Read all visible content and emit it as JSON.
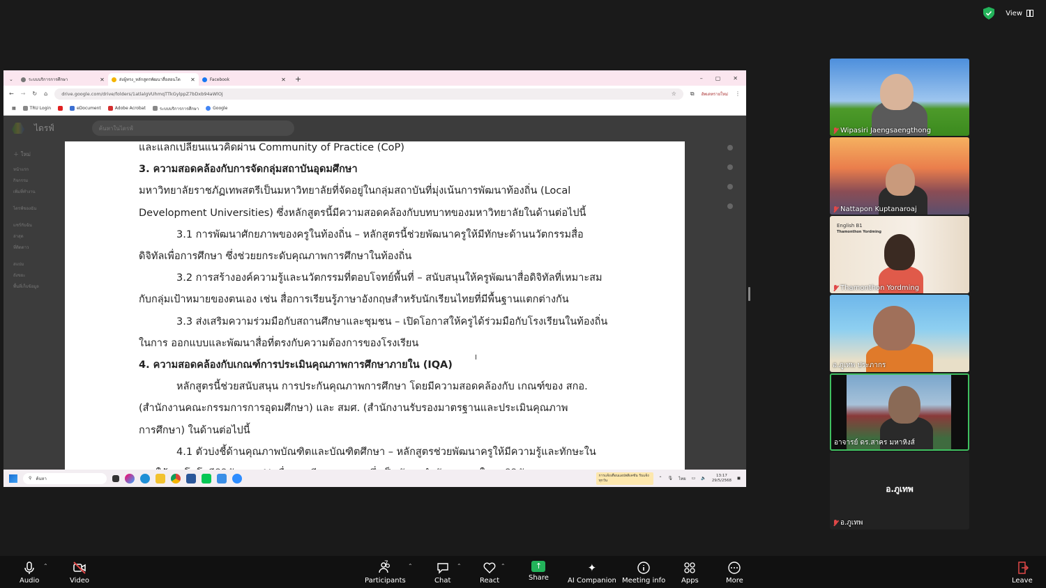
{
  "topbar": {
    "view_label": "View"
  },
  "browser": {
    "tabs": [
      {
        "title": "ระบบบริการการศึกษา",
        "active": false
      },
      {
        "title": "ส่งผู้ทรง_หลักสูตรพัฒนาสื่อสอนโด",
        "active": true
      },
      {
        "title": "Facebook",
        "active": false
      }
    ],
    "new_tab": "+",
    "url": "drive.google.com/drive/folders/1atlalgVUhmqTTkGylppZ7bDxb94aWlOj",
    "profile_label": "อัพเดทรายใหม่",
    "bookmarks": [
      "TRU Login",
      "eDocument",
      "Adobe Acrobat",
      "ระบบบริการการศึกษา",
      "Google"
    ]
  },
  "drive": {
    "app_name": "ไดรฟ์",
    "search_placeholder": "ค้นหาในไดรฟ์",
    "new_label": "ใหม่",
    "side_items": [
      "หน้าแรก",
      "กิจกรรม",
      "เพิ่มที่ทำงาน",
      "ไดรฟ์ของฉัน",
      "แชร์กับฉัน",
      "ล่าสุด",
      "ที่ติดดาว",
      "สแปม",
      "ถังขยะ",
      "พื้นที่เก็บข้อมูล"
    ]
  },
  "document": {
    "lines": [
      {
        "text": "และแลกเปลี่ยนแนวคิดผ่าน Community of Practice (CoP)",
        "style": "normal"
      },
      {
        "text": "3. ความสอดคล้องกับการจัดกลุ่มสถาบันอุดมศึกษา",
        "style": "heading"
      },
      {
        "text": "มหาวิทยาลัยราชภัฏเทพสตรีเป็นมหาวิทยาลัยที่จัดอยู่ในกลุ่มสถาบันที่มุ่งเน้นการพัฒนาท้องถิ่น (Local",
        "style": "normal"
      },
      {
        "text": "Development Universities) ซึ่งหลักสูตรนี้มีความสอดคล้องกับบทบาทของมหาวิทยาลัยในด้านต่อไปนี้",
        "style": "normal"
      },
      {
        "text": "3.1 การพัฒนาศักยภาพของครูในท้องถิ่น – หลักสูตรนี้ช่วยพัฒนาครูให้มีทักษะด้านนวัตกรรมสื่อ",
        "style": "indent"
      },
      {
        "text": "ดิจิทัลเพื่อการศึกษา ซึ่งช่วยยกระดับคุณภาพการศึกษาในท้องถิ่น",
        "style": "normal"
      },
      {
        "text": "3.2 การสร้างองค์ความรู้และนวัตกรรมที่ตอบโจทย์พื้นที่ – สนับสนุนให้ครูพัฒนาสื่อดิจิทัลที่เหมาะสม",
        "style": "indent"
      },
      {
        "text": "กับกลุ่มเป้าหมายของตนเอง เช่น สื่อการเรียนรู้ภาษาอังกฤษสำหรับนักเรียนไทยที่มีพื้นฐานแตกต่างกัน",
        "style": "normal"
      },
      {
        "text": "3.3 ส่งเสริมความร่วมมือกับสถานศึกษาและชุมชน – เปิดโอกาสให้ครูได้ร่วมมือกับโรงเรียนในท้องถิ่น",
        "style": "indent"
      },
      {
        "text": "ในการ ออกแบบและพัฒนาสื่อที่ตรงกับความต้องการของโรงเรียน",
        "style": "normal"
      },
      {
        "text": "4. ความสอดคล้องกับเกณฑ์การประเมินคุณภาพการศึกษาภายใน (IQA)",
        "style": "heading"
      },
      {
        "text": "หลักสูตรนี้ช่วยสนับสนุน การประกันคุณภาพการศึกษา โดยมีความสอดคล้องกับ เกณฑ์ของ สกอ.",
        "style": "indent"
      },
      {
        "text": "(สำนักงานคณะกรรมการการอุดมศึกษา) และ สมศ. (สำนักงานรับรองมาตรฐานและประเมินคุณภาพ",
        "style": "normal"
      },
      {
        "text": "การศึกษา) ในด้านต่อไปนี้",
        "style": "normal"
      },
      {
        "text": "4.1 ตัวบ่งชี้ด้านคุณภาพบัณฑิตและบัณฑิตศึกษา – หลักสูตรช่วยพัฒนาครูให้มีความรู้และทักษะใน",
        "style": "indent"
      },
      {
        "text": "การใช้เทคโนโลยีดิจิทัลและ AI เพื่อการเรียนการสอน ซึ่งเป็นทักษะสำคัญของครูในยุคดิจิทัล",
        "style": "normal"
      }
    ]
  },
  "taskbar": {
    "search_placeholder": "ค้นหา",
    "notification": "การแจ้งเตือนแอปพลิเคชัน รับแจ้งทุกวัน",
    "lang": "ไทย",
    "time": "13:17",
    "date": "29/5/2568"
  },
  "participants": [
    {
      "name": "Wipasiri Jaengsaengthong",
      "muted": true
    },
    {
      "name": "Nattapon Kuptanaroaj",
      "muted": true
    },
    {
      "name": "Thamonthon Yordming",
      "muted": true,
      "caption_line1": "English B1",
      "caption_line2": "Thamonthon Yordming"
    },
    {
      "name": "อ.ภูเทพ ประภากร",
      "muted": false
    },
    {
      "name": "อาจารย์ ดร.สาคร มหาหิงส์",
      "muted": false,
      "active_speaker": true
    },
    {
      "name": "อ.ภูเทพ",
      "muted": true,
      "video_off": true,
      "display_name": "อ.ภูเทพ"
    }
  ],
  "toolbar": {
    "audio": "Audio",
    "video": "Video",
    "participants": "Participants",
    "participants_count": "7",
    "chat": "Chat",
    "react": "React",
    "share": "Share",
    "ai_companion": "AI Companion",
    "meeting_info": "Meeting info",
    "apps": "Apps",
    "more": "More",
    "leave": "Leave"
  },
  "colors": {
    "active_speaker_border": "#3fbf5f",
    "share_green": "#23b35a",
    "muted_red": "#e04848"
  }
}
